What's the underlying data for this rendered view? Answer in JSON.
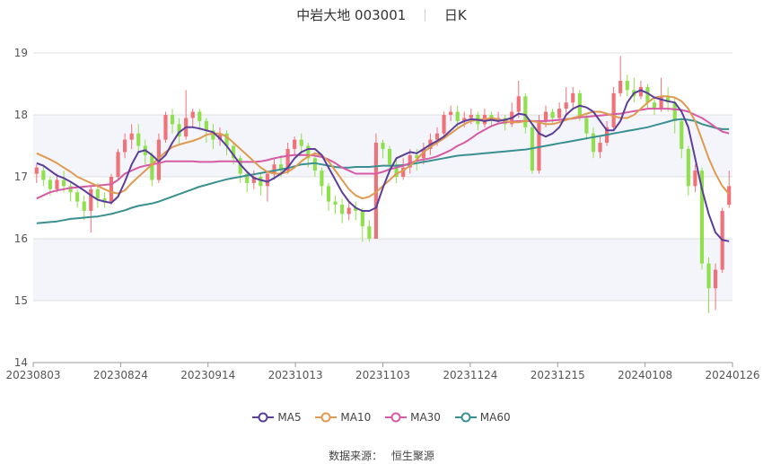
{
  "header": {
    "title": "中岩大地 003001",
    "period": "日K"
  },
  "source": {
    "label": "数据来源：",
    "provider": "恒生聚源"
  },
  "colors": {
    "up": "#f07178",
    "down": "#8fe04c",
    "ma5": "#5b3d9a",
    "ma10": "#e09a50",
    "ma30": "#d65aa4",
    "ma60": "#3a9090",
    "grid": "#e0e0e0",
    "band": "#f4f5fb"
  },
  "chart_data": {
    "type": "candlestick",
    "title": "中岩大地 003001",
    "period": "日K",
    "ylim": [
      14,
      19
    ],
    "yticks": [
      14,
      15,
      16,
      17,
      18,
      19
    ],
    "xtick_labels": [
      "20230803",
      "20230824",
      "20230914",
      "20231013",
      "20231103",
      "20231124",
      "20231215",
      "20240108",
      "20240126"
    ],
    "legend": [
      "MA5",
      "MA10",
      "MA30",
      "MA60"
    ],
    "legend_position": "bottom",
    "candles": [
      [
        17.05,
        17.15,
        16.9,
        17.2
      ],
      [
        17.1,
        16.95,
        16.85,
        17.2
      ],
      [
        16.95,
        16.8,
        16.7,
        17.0
      ],
      [
        16.8,
        16.95,
        16.75,
        17.05
      ],
      [
        16.95,
        16.85,
        16.75,
        17.1
      ],
      [
        16.85,
        16.75,
        16.6,
        16.9
      ],
      [
        16.75,
        16.6,
        16.5,
        16.8
      ],
      [
        16.6,
        16.45,
        16.3,
        16.7
      ],
      [
        16.45,
        16.8,
        16.1,
        16.85
      ],
      [
        16.8,
        16.65,
        16.5,
        16.9
      ],
      [
        16.65,
        16.6,
        16.5,
        16.75
      ],
      [
        16.6,
        17.0,
        16.55,
        17.05
      ],
      [
        17.0,
        17.4,
        16.95,
        17.45
      ],
      [
        17.4,
        17.6,
        17.3,
        17.7
      ],
      [
        17.6,
        17.7,
        17.45,
        17.85
      ],
      [
        17.7,
        17.5,
        17.4,
        17.85
      ],
      [
        17.5,
        17.35,
        17.2,
        17.6
      ],
      [
        17.35,
        16.95,
        16.85,
        17.4
      ],
      [
        16.95,
        17.6,
        16.9,
        17.7
      ],
      [
        17.6,
        18.0,
        17.55,
        18.05
      ],
      [
        18.0,
        17.85,
        17.7,
        18.1
      ],
      [
        17.85,
        17.65,
        17.5,
        17.95
      ],
      [
        17.65,
        17.95,
        17.6,
        18.4
      ],
      [
        17.95,
        18.05,
        17.8,
        18.1
      ],
      [
        18.05,
        17.9,
        17.75,
        18.1
      ],
      [
        17.9,
        17.75,
        17.55,
        17.95
      ],
      [
        17.75,
        17.6,
        17.45,
        17.85
      ],
      [
        17.6,
        17.7,
        17.5,
        17.8
      ],
      [
        17.7,
        17.5,
        17.35,
        17.75
      ],
      [
        17.5,
        17.3,
        17.2,
        17.55
      ],
      [
        17.3,
        17.05,
        16.9,
        17.35
      ],
      [
        17.05,
        16.9,
        16.75,
        17.1
      ],
      [
        16.9,
        17.0,
        16.8,
        17.1
      ],
      [
        17.0,
        16.85,
        16.7,
        17.05
      ],
      [
        16.85,
        17.05,
        16.6,
        17.1
      ],
      [
        17.05,
        17.2,
        16.95,
        17.3
      ],
      [
        17.2,
        17.1,
        17.0,
        17.35
      ],
      [
        17.1,
        17.45,
        17.05,
        17.55
      ],
      [
        17.45,
        17.6,
        17.35,
        17.65
      ],
      [
        17.6,
        17.5,
        17.35,
        17.7
      ],
      [
        17.5,
        17.3,
        17.15,
        17.55
      ],
      [
        17.3,
        17.1,
        17.0,
        17.4
      ],
      [
        17.1,
        16.85,
        16.7,
        17.15
      ],
      [
        16.85,
        16.6,
        16.45,
        16.9
      ],
      [
        16.6,
        16.55,
        16.4,
        16.7
      ],
      [
        16.55,
        16.4,
        16.25,
        16.65
      ],
      [
        16.4,
        16.5,
        16.3,
        16.6
      ],
      [
        16.5,
        16.45,
        16.3,
        16.6
      ],
      [
        16.45,
        16.2,
        15.95,
        16.5
      ],
      [
        16.2,
        16.0,
        15.95,
        16.3
      ],
      [
        16.0,
        17.55,
        16.0,
        17.7
      ],
      [
        17.55,
        17.45,
        17.3,
        17.6
      ],
      [
        17.45,
        17.2,
        17.1,
        17.5
      ],
      [
        17.2,
        17.0,
        16.9,
        17.3
      ],
      [
        17.0,
        17.15,
        16.95,
        17.3
      ],
      [
        17.15,
        17.35,
        17.05,
        17.45
      ],
      [
        17.35,
        17.3,
        17.1,
        17.45
      ],
      [
        17.3,
        17.45,
        17.2,
        17.55
      ],
      [
        17.45,
        17.6,
        17.35,
        17.7
      ],
      [
        17.6,
        17.7,
        17.5,
        17.8
      ],
      [
        17.7,
        18.0,
        17.65,
        18.05
      ],
      [
        18.0,
        18.05,
        17.9,
        18.15
      ],
      [
        18.05,
        17.9,
        17.8,
        18.15
      ],
      [
        17.9,
        17.95,
        17.8,
        18.05
      ],
      [
        17.95,
        18.0,
        17.85,
        18.1
      ],
      [
        18.0,
        17.85,
        17.75,
        18.05
      ],
      [
        17.85,
        18.0,
        17.8,
        18.1
      ],
      [
        18.0,
        17.9,
        17.8,
        18.05
      ],
      [
        17.9,
        17.95,
        17.85,
        18.05
      ],
      [
        17.95,
        17.85,
        17.75,
        18.0
      ],
      [
        17.85,
        18.05,
        17.8,
        18.2
      ],
      [
        18.05,
        18.3,
        17.95,
        18.55
      ],
      [
        18.3,
        17.8,
        17.7,
        18.35
      ],
      [
        17.8,
        17.1,
        17.05,
        17.85
      ],
      [
        17.1,
        17.9,
        17.05,
        18.0
      ],
      [
        17.9,
        18.05,
        17.8,
        18.15
      ],
      [
        18.05,
        17.95,
        17.85,
        18.1
      ],
      [
        17.95,
        18.1,
        17.9,
        18.2
      ],
      [
        18.1,
        18.2,
        18.0,
        18.45
      ],
      [
        18.2,
        18.35,
        18.1,
        18.45
      ],
      [
        18.35,
        17.95,
        17.9,
        18.4
      ],
      [
        17.95,
        17.7,
        17.6,
        18.0
      ],
      [
        17.7,
        17.4,
        17.3,
        17.8
      ],
      [
        17.4,
        17.55,
        17.3,
        17.65
      ],
      [
        17.55,
        17.8,
        17.5,
        17.9
      ],
      [
        17.8,
        18.35,
        17.75,
        18.45
      ],
      [
        18.35,
        18.55,
        18.3,
        18.95
      ],
      [
        18.55,
        18.4,
        18.3,
        18.65
      ],
      [
        18.4,
        18.3,
        18.2,
        18.6
      ],
      [
        18.3,
        18.45,
        18.25,
        18.55
      ],
      [
        18.45,
        18.2,
        18.1,
        18.5
      ],
      [
        18.2,
        18.1,
        18.0,
        18.3
      ],
      [
        18.1,
        18.3,
        18.05,
        18.6
      ],
      [
        18.3,
        18.2,
        18.05,
        18.45
      ],
      [
        18.2,
        17.9,
        17.7,
        18.3
      ],
      [
        17.9,
        17.45,
        17.3,
        17.95
      ],
      [
        17.45,
        16.85,
        16.7,
        17.5
      ],
      [
        16.85,
        17.1,
        16.75,
        17.2
      ],
      [
        17.1,
        15.6,
        15.5,
        17.15
      ],
      [
        15.6,
        15.2,
        14.8,
        15.7
      ],
      [
        15.2,
        15.5,
        14.85,
        15.6
      ],
      [
        15.5,
        16.45,
        15.45,
        16.5
      ],
      [
        16.55,
        16.85,
        16.5,
        17.1
      ]
    ],
    "ma5": [
      17.22,
      17.18,
      17.1,
      17.02,
      16.98,
      16.92,
      16.85,
      16.78,
      16.7,
      16.63,
      16.6,
      16.58,
      16.68,
      16.92,
      17.2,
      17.4,
      17.43,
      17.35,
      17.25,
      17.35,
      17.55,
      17.72,
      17.8,
      17.8,
      17.78,
      17.75,
      17.72,
      17.62,
      17.5,
      17.35,
      17.2,
      17.08,
      16.98,
      16.95,
      16.92,
      16.98,
      17.05,
      17.15,
      17.3,
      17.4,
      17.45,
      17.45,
      17.35,
      17.15,
      16.95,
      16.75,
      16.6,
      16.5,
      16.45,
      16.45,
      16.5,
      16.82,
      17.1,
      17.3,
      17.35,
      17.4,
      17.38,
      17.45,
      17.52,
      17.58,
      17.65,
      17.75,
      17.85,
      17.9,
      17.93,
      17.92,
      17.9,
      17.92,
      17.9,
      17.92,
      17.95,
      18.02,
      18.0,
      17.85,
      17.7,
      17.65,
      17.7,
      17.8,
      18.0,
      18.1,
      18.15,
      18.12,
      18.05,
      17.9,
      17.75,
      17.75,
      17.9,
      18.2,
      18.35,
      18.4,
      18.35,
      18.28,
      18.25,
      18.22,
      18.2,
      18.05,
      17.8,
      17.3,
      16.8,
      16.4,
      16.1,
      15.98,
      15.96
    ],
    "ma10": [
      17.38,
      17.33,
      17.28,
      17.22,
      17.15,
      17.08,
      17.0,
      16.95,
      16.9,
      16.85,
      16.8,
      16.75,
      16.73,
      16.78,
      16.9,
      17.0,
      17.1,
      17.2,
      17.3,
      17.4,
      17.48,
      17.52,
      17.55,
      17.58,
      17.62,
      17.68,
      17.7,
      17.7,
      17.65,
      17.55,
      17.45,
      17.35,
      17.25,
      17.15,
      17.08,
      17.05,
      17.05,
      17.08,
      17.15,
      17.25,
      17.33,
      17.38,
      17.35,
      17.25,
      17.1,
      16.95,
      16.8,
      16.7,
      16.65,
      16.68,
      16.75,
      16.85,
      16.95,
      17.05,
      17.1,
      17.18,
      17.28,
      17.4,
      17.48,
      17.55,
      17.62,
      17.7,
      17.78,
      17.85,
      17.9,
      17.92,
      17.93,
      17.95,
      17.93,
      17.9,
      17.88,
      17.88,
      17.9,
      17.9,
      17.88,
      17.85,
      17.85,
      17.88,
      17.92,
      17.95,
      17.98,
      18.02,
      18.05,
      18.05,
      18.02,
      17.98,
      17.95,
      17.95,
      18.0,
      18.1,
      18.2,
      18.28,
      18.3,
      18.3,
      18.28,
      18.22,
      18.1,
      17.9,
      17.6,
      17.3,
      17.05,
      16.85,
      16.72
    ],
    "ma30": [
      16.65,
      16.7,
      16.75,
      16.78,
      16.8,
      16.82,
      16.83,
      16.84,
      16.85,
      16.86,
      16.87,
      16.88,
      16.95,
      17.05,
      17.1,
      17.15,
      17.18,
      17.2,
      17.22,
      17.25,
      17.25,
      17.25,
      17.25,
      17.25,
      17.24,
      17.24,
      17.24,
      17.25,
      17.25,
      17.25,
      17.24,
      17.24,
      17.24,
      17.25,
      17.27,
      17.3,
      17.32,
      17.34,
      17.35,
      17.35,
      17.35,
      17.34,
      17.32,
      17.28,
      17.22,
      17.15,
      17.1,
      17.05,
      17.05,
      17.05,
      17.05,
      17.08,
      17.12,
      17.15,
      17.18,
      17.22,
      17.26,
      17.28,
      17.3,
      17.33,
      17.38,
      17.43,
      17.5,
      17.55,
      17.62,
      17.7,
      17.76,
      17.82,
      17.86,
      17.88,
      17.89,
      17.9,
      17.9,
      17.9,
      17.9,
      17.9,
      17.91,
      17.92,
      17.93,
      17.94,
      17.96,
      17.97,
      17.98,
      17.99,
      18.0,
      18.01,
      18.02,
      18.04,
      18.06,
      18.08,
      18.1,
      18.1,
      18.1,
      18.1,
      18.09,
      18.08,
      18.05,
      18.0,
      17.95,
      17.88,
      17.8,
      17.73,
      17.7
    ],
    "ma60": [
      16.25,
      16.26,
      16.27,
      16.28,
      16.3,
      16.32,
      16.33,
      16.34,
      16.35,
      16.36,
      16.38,
      16.4,
      16.43,
      16.46,
      16.5,
      16.53,
      16.55,
      16.57,
      16.6,
      16.64,
      16.68,
      16.72,
      16.76,
      16.8,
      16.84,
      16.87,
      16.9,
      16.93,
      16.96,
      16.98,
      17.0,
      17.02,
      17.04,
      17.06,
      17.08,
      17.1,
      17.12,
      17.14,
      17.17,
      17.2,
      17.21,
      17.22,
      17.2,
      17.18,
      17.16,
      17.15,
      17.15,
      17.16,
      17.16,
      17.16,
      17.17,
      17.18,
      17.18,
      17.18,
      17.19,
      17.2,
      17.22,
      17.24,
      17.26,
      17.28,
      17.3,
      17.32,
      17.34,
      17.35,
      17.36,
      17.37,
      17.38,
      17.39,
      17.4,
      17.41,
      17.42,
      17.43,
      17.44,
      17.46,
      17.48,
      17.5,
      17.52,
      17.54,
      17.56,
      17.58,
      17.6,
      17.62,
      17.64,
      17.66,
      17.68,
      17.7,
      17.72,
      17.74,
      17.76,
      17.78,
      17.8,
      17.83,
      17.86,
      17.89,
      17.92,
      17.93,
      17.92,
      17.9,
      17.85,
      17.82,
      17.79,
      17.77,
      17.77
    ]
  }
}
